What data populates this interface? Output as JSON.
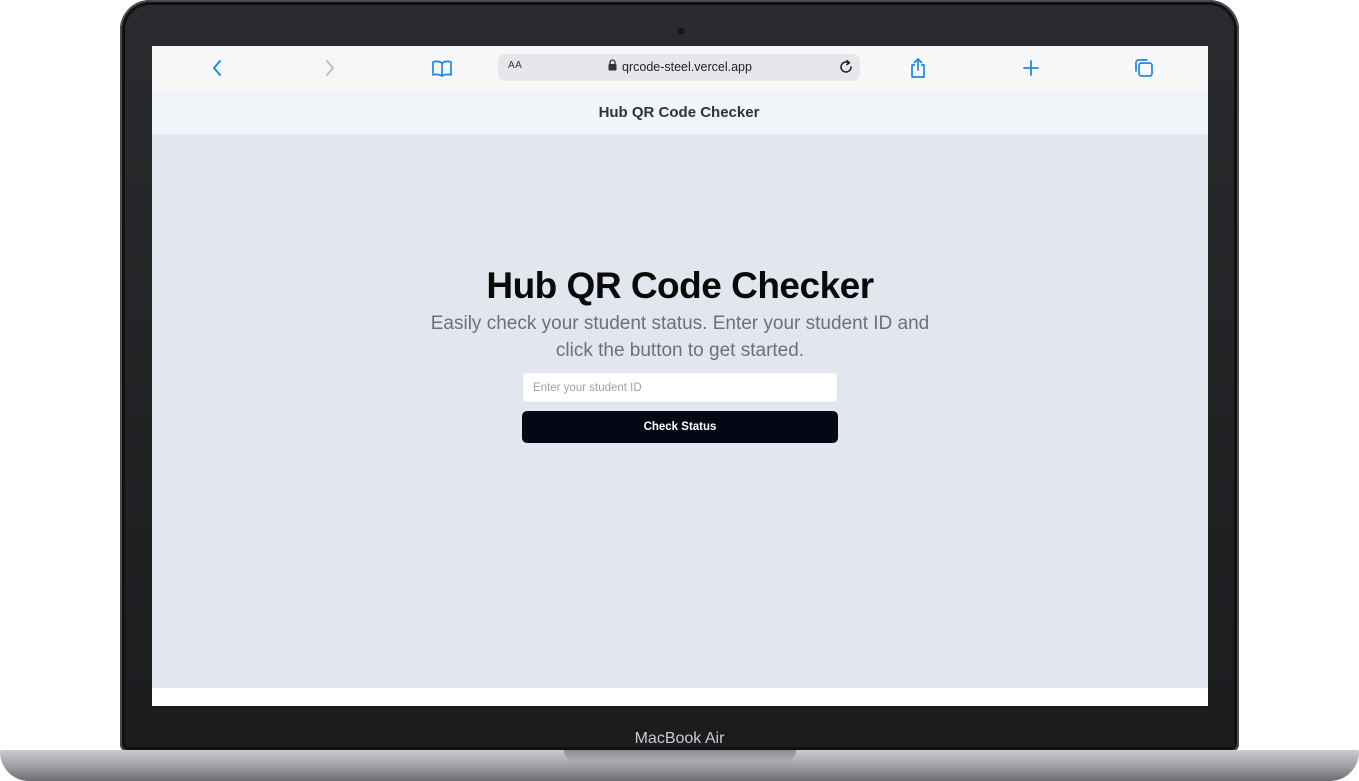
{
  "device": {
    "brand_label": "MacBook Air"
  },
  "browser": {
    "text_size_label": "AA",
    "url": "qrcode-steel.vercel.app",
    "icons": {
      "back": "chevron-left-icon",
      "forward": "chevron-right-icon",
      "bookmarks": "book-icon",
      "lock": "lock-icon",
      "reload": "reload-icon",
      "share": "share-icon",
      "new_tab": "plus-icon",
      "tabs": "tabs-icon"
    },
    "accent_color": "#1e88e5"
  },
  "site": {
    "header_title": "Hub QR Code Checker"
  },
  "hero": {
    "title": "Hub QR Code Checker",
    "subtitle": "Easily check your student status. Enter your student ID and click the button to get started."
  },
  "form": {
    "student_id_value": "",
    "student_id_placeholder": "Enter your student ID",
    "submit_label": "Check Status",
    "button_color": "#050814"
  }
}
